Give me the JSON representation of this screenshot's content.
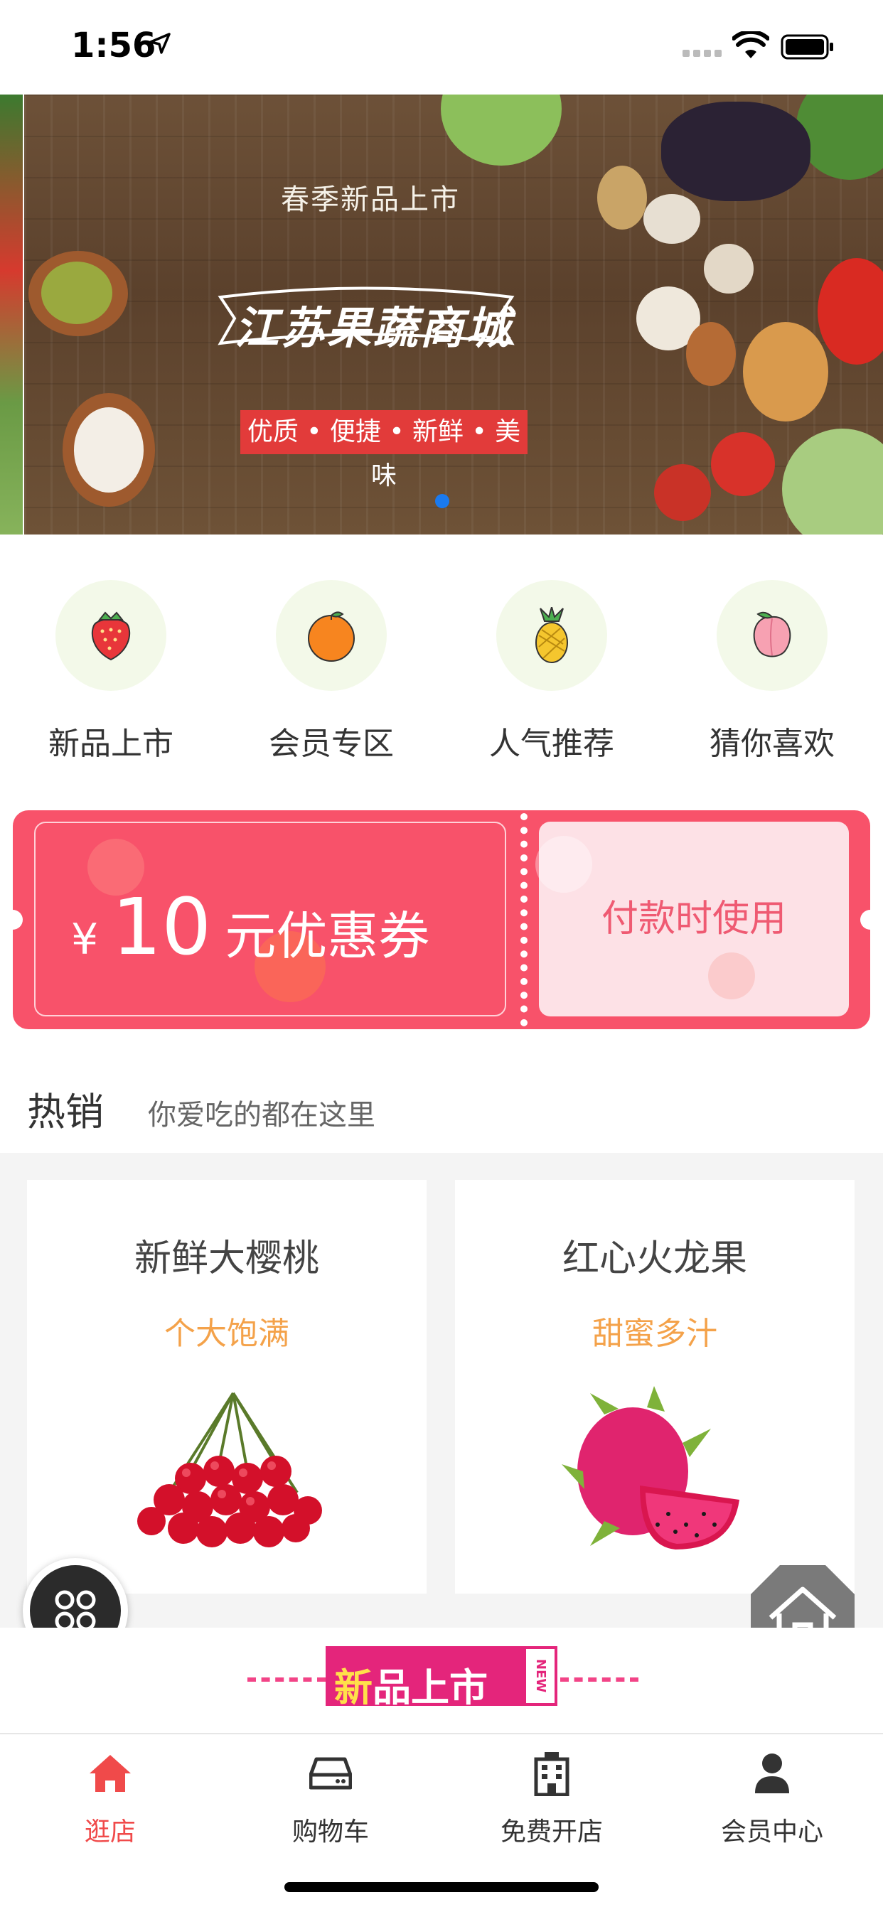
{
  "status_bar": {
    "time": "1:56"
  },
  "banner": {
    "subtitle": "春季新品上市",
    "title": "江苏果蔬商城",
    "tagline": "优质 • 便捷 • 新鲜 • 美味"
  },
  "categories": [
    {
      "label": "新品上市",
      "icon": "strawberry-icon"
    },
    {
      "label": "会员专区",
      "icon": "orange-icon"
    },
    {
      "label": "人气推荐",
      "icon": "pineapple-icon"
    },
    {
      "label": "猜你喜欢",
      "icon": "peach-icon"
    }
  ],
  "coupon": {
    "currency": "¥",
    "amount": "10",
    "unit_text": "元优惠券",
    "action": "付款时使用"
  },
  "hot_section": {
    "title": "热销",
    "subtitle": "你爱吃的都在这里"
  },
  "products": [
    {
      "name": "新鲜大樱桃",
      "desc": "个大饱满",
      "image": "cherries"
    },
    {
      "name": "红心火龙果",
      "desc": "甜蜜多汁",
      "image": "dragon-fruit"
    }
  ],
  "new_banner": {
    "first_char": "新",
    "rest": "品上市",
    "tag": "NEW"
  },
  "tabbar": {
    "items": [
      {
        "label": "逛店",
        "icon": "home-icon",
        "active": true
      },
      {
        "label": "购物车",
        "icon": "cart-icon",
        "active": false
      },
      {
        "label": "免费开店",
        "icon": "building-icon",
        "active": false
      },
      {
        "label": "会员中心",
        "icon": "user-icon",
        "active": false
      }
    ]
  },
  "colors": {
    "accent": "#f04a4a",
    "coupon": "#f8526a",
    "desc": "#f4a24a"
  }
}
